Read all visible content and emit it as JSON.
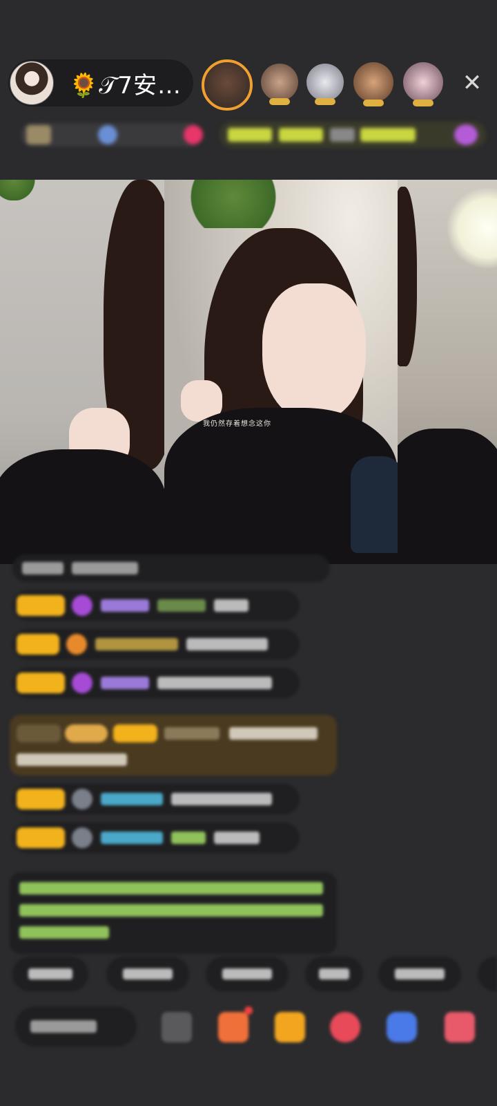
{
  "header": {
    "host_name": "🌻𝒯7安…",
    "close_glyph": "✕"
  },
  "video": {
    "overlay_caption": "我仍然存着想念这你"
  },
  "colors": {
    "background": "#2b2b2d",
    "badge_gold": "#f2b21c",
    "accent_green": "#8fc25a"
  }
}
